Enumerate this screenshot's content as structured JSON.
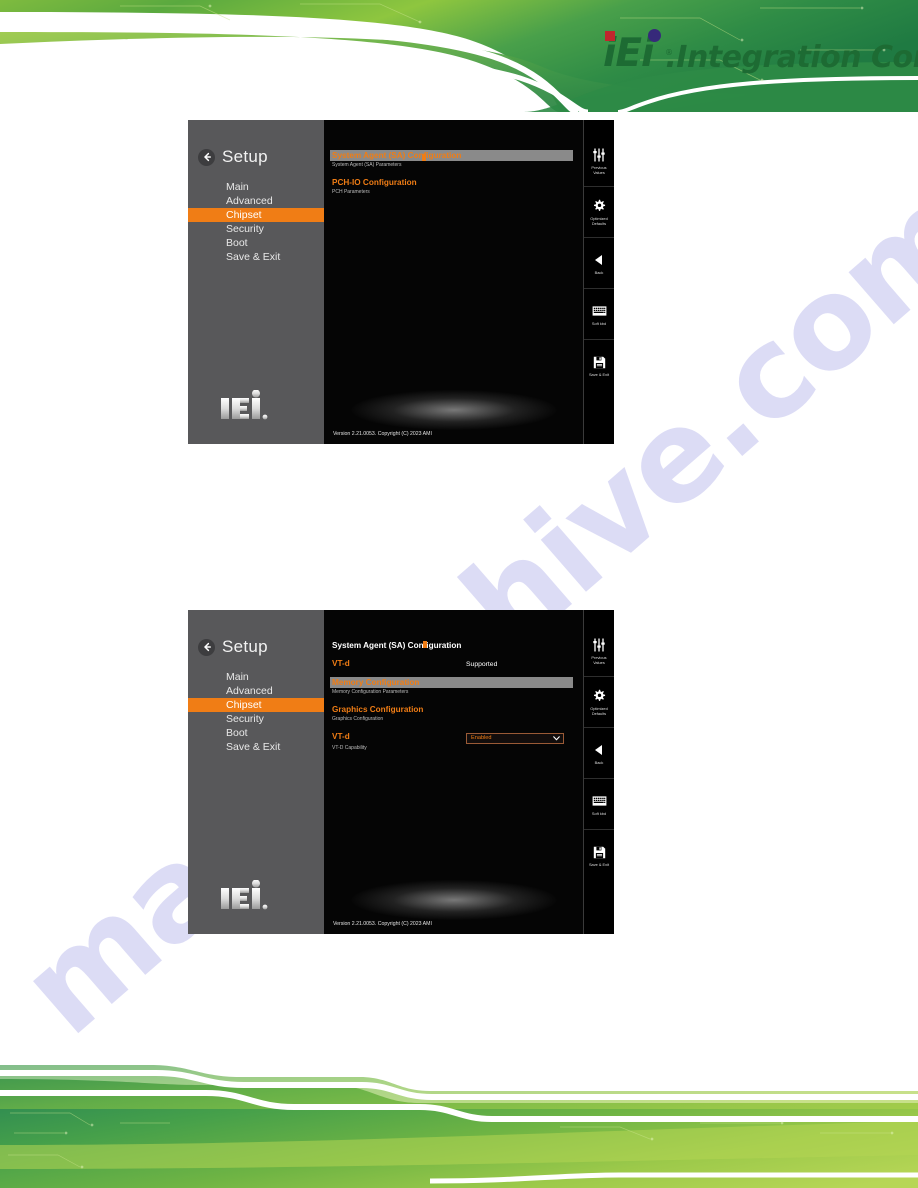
{
  "header": {
    "logo_mark": "iEi",
    "logo_registered": "®",
    "logo_wordmark": ".Integration Corp.",
    "brand_green": "#1d6b33",
    "brand_red": "#c0272d",
    "brand_blue": "#36297a",
    "banner_green_dark": "#3f9647",
    "banner_green_light": "#a8cf45"
  },
  "watermark": {
    "text": "manualshive.com",
    "color": "#c8c8f0"
  },
  "screenshots": [
    {
      "id": "bios-chipset-menu",
      "nav": {
        "title": "Setup",
        "back_icon": "back-arrow-icon",
        "items": [
          {
            "label": "Main",
            "active": false
          },
          {
            "label": "Advanced",
            "active": false
          },
          {
            "label": "Chipset",
            "active": true
          },
          {
            "label": "Security",
            "active": false
          },
          {
            "label": "Boot",
            "active": false
          },
          {
            "label": "Save & Exit",
            "active": false
          }
        ],
        "logo": "iei-logo"
      },
      "main": {
        "entries": [
          {
            "kind": "link",
            "label": "System Agent (SA) Configuration",
            "description": "System Agent (SA) Parameters",
            "selected": true
          },
          {
            "kind": "link",
            "label": "PCH-IO Configuration",
            "description": "PCH Parameters",
            "selected": false
          }
        ],
        "version": "Version 2.21.0053. Copyright (C) 2023 AMI"
      },
      "rail": [
        {
          "icon": "sliders-icon",
          "label": "Previous\nValues"
        },
        {
          "icon": "gear-icon",
          "label": "Optimized\nDefaults"
        },
        {
          "icon": "back-triangle-icon",
          "label": "Back"
        },
        {
          "icon": "keyboard-icon",
          "label": "Soft kbd"
        },
        {
          "icon": "floppy-disk-icon",
          "label": "Save & Exit"
        }
      ]
    },
    {
      "id": "bios-system-agent-config",
      "nav": {
        "title": "Setup",
        "back_icon": "back-arrow-icon",
        "items": [
          {
            "label": "Main",
            "active": false
          },
          {
            "label": "Advanced",
            "active": false
          },
          {
            "label": "Chipset",
            "active": true
          },
          {
            "label": "Security",
            "active": false
          },
          {
            "label": "Boot",
            "active": false
          },
          {
            "label": "Save & Exit",
            "active": false
          }
        ],
        "logo": "iei-logo"
      },
      "main": {
        "page_title": "System Agent (SA) Configuration",
        "entries": [
          {
            "kind": "value",
            "label": "VT-d",
            "value": "Supported"
          },
          {
            "kind": "link",
            "label": "Memory Configuration",
            "description": "Memory Configuration Parameters",
            "selected": true
          },
          {
            "kind": "link",
            "label": "Graphics Configuration",
            "description": "Graphics Configuration",
            "selected": false
          },
          {
            "kind": "select",
            "label": "VT-d",
            "value": "Enabled",
            "description": "VT-D Capability"
          }
        ],
        "version": "Version 2.21.0053. Copyright (C) 2023 AMI"
      },
      "rail": [
        {
          "icon": "sliders-icon",
          "label": "Previous\nValues"
        },
        {
          "icon": "gear-icon",
          "label": "Optimized\nDefaults"
        },
        {
          "icon": "back-triangle-icon",
          "label": "Back"
        },
        {
          "icon": "keyboard-icon",
          "label": "Soft kbd"
        },
        {
          "icon": "floppy-disk-icon",
          "label": "Save & Exit"
        }
      ]
    }
  ]
}
